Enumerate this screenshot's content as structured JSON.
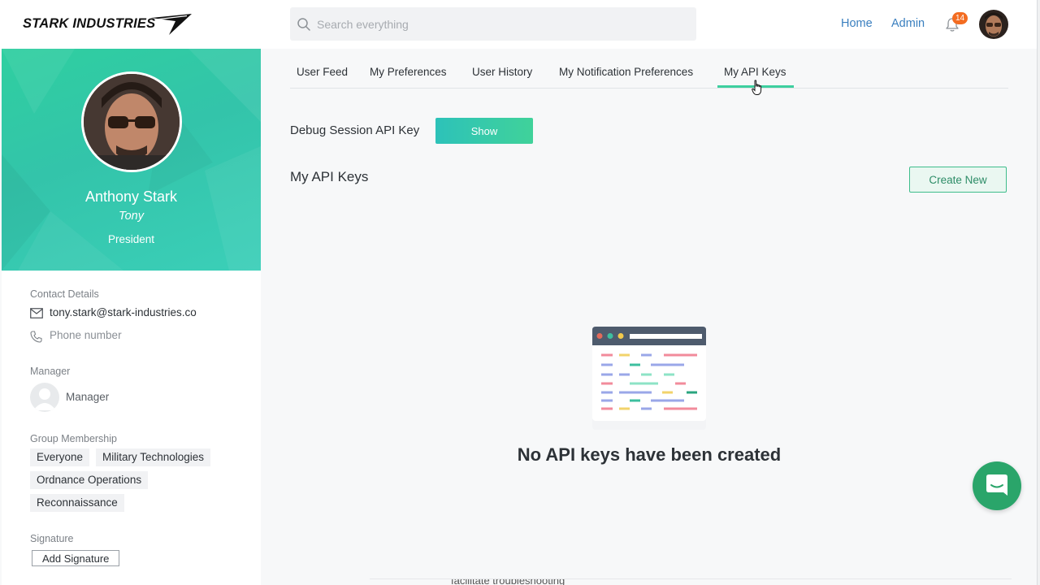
{
  "header": {
    "logo_text": "STARK INDUSTRIES",
    "search_placeholder": "Search everything",
    "nav": [
      {
        "label": "Home"
      },
      {
        "label": "Admin"
      }
    ],
    "notification_count": "14",
    "icons": {
      "search": "search-icon",
      "notifications": "bell-icon",
      "avatar": "user-avatar"
    }
  },
  "profile": {
    "name": "Anthony Stark",
    "nickname": "Tony",
    "title": "President"
  },
  "sidebar": {
    "contact_details_label": "Contact Details",
    "email": "tony.stark@stark-industries.co",
    "phone_placeholder": "Phone number",
    "manager_label": "Manager",
    "manager_name": "Manager",
    "group_membership_label": "Group Membership",
    "groups": [
      "Everyone",
      "Military Technologies",
      "Ordnance Operations",
      "Reconnaissance"
    ],
    "signature_label": "Signature",
    "add_signature_label": "Add Signature"
  },
  "tabs": [
    {
      "label": "User Feed"
    },
    {
      "label": "My Preferences"
    },
    {
      "label": "User History"
    },
    {
      "label": "My Notification Preferences"
    },
    {
      "label": "My API Keys",
      "active": true
    }
  ],
  "main": {
    "debug_label": "Debug Session API Key",
    "show_label": "Show",
    "section_title": "My API Keys",
    "create_label": "Create New",
    "empty_message": "No API keys have been created",
    "bottom_text": "facilitate troubleshooting"
  },
  "colors": {
    "accent": "#3ecf9f",
    "link": "#3a7fbf",
    "badge": "#f36c21",
    "chat": "#2aa56a"
  }
}
